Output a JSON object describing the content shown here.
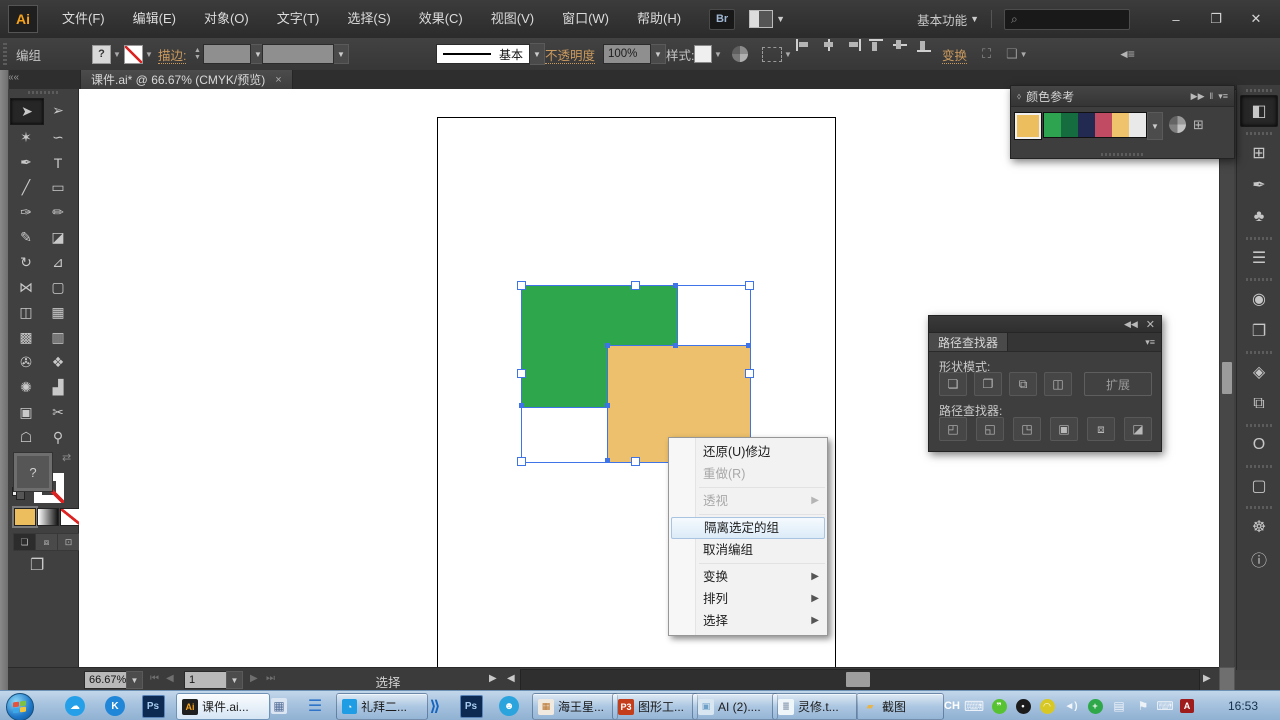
{
  "menu_bar": {
    "logo": "Ai",
    "items": [
      "文件(F)",
      "编辑(E)",
      "对象(O)",
      "文字(T)",
      "选择(S)",
      "效果(C)",
      "视图(V)",
      "窗口(W)",
      "帮助(H)"
    ],
    "bridge_button": "Br",
    "workspace_switcher": "基本功能",
    "window_controls": {
      "minimize": "–",
      "maximize": "❐",
      "close": "✕"
    }
  },
  "control_bar": {
    "selection_type": "编组",
    "fill_indicator": "?",
    "stroke_label": "描边:",
    "brush_definition": "基本",
    "opacity_label": "不透明度",
    "opacity_value": "100%",
    "style_label": "样式:",
    "transform_label": "变换"
  },
  "tab_bar": {
    "document_title": "课件.ai* @ 66.67% (CMYK/预览)",
    "close": "×"
  },
  "toolbar": {
    "fill_value": "?",
    "tools": [
      {
        "name": "selection-tool",
        "glyph": "➤",
        "active": true
      },
      {
        "name": "direct-selection-tool",
        "glyph": "➢",
        "active": false
      },
      {
        "name": "magic-wand-tool",
        "glyph": "✶",
        "active": false
      },
      {
        "name": "lasso-tool",
        "glyph": "∽",
        "active": false
      },
      {
        "name": "pen-tool",
        "glyph": "✒",
        "active": false
      },
      {
        "name": "type-tool",
        "glyph": "T",
        "active": false
      },
      {
        "name": "line-segment-tool",
        "glyph": "╱",
        "active": false
      },
      {
        "name": "rectangle-tool",
        "glyph": "▭",
        "active": false
      },
      {
        "name": "paintbrush-tool",
        "glyph": "✑",
        "active": false
      },
      {
        "name": "pencil-tool",
        "glyph": "✏",
        "active": false
      },
      {
        "name": "blob-brush-tool",
        "glyph": "✎",
        "active": false
      },
      {
        "name": "eraser-tool",
        "glyph": "◪",
        "active": false
      },
      {
        "name": "rotate-tool",
        "glyph": "↻",
        "active": false
      },
      {
        "name": "scale-tool",
        "glyph": "⊿",
        "active": false
      },
      {
        "name": "width-tool",
        "glyph": "⋈",
        "active": false
      },
      {
        "name": "free-transform-tool",
        "glyph": "▢",
        "active": false
      },
      {
        "name": "shape-builder-tool",
        "glyph": "◫",
        "active": false
      },
      {
        "name": "perspective-grid-tool",
        "glyph": "▦",
        "active": false
      },
      {
        "name": "mesh-tool",
        "glyph": "▩",
        "active": false
      },
      {
        "name": "gradient-tool",
        "glyph": "▥",
        "active": false
      },
      {
        "name": "eyedropper-tool",
        "glyph": "✇",
        "active": false
      },
      {
        "name": "blend-tool",
        "glyph": "❖",
        "active": false
      },
      {
        "name": "symbol-sprayer-tool",
        "glyph": "✺",
        "active": false
      },
      {
        "name": "column-graph-tool",
        "glyph": "▟",
        "active": false
      },
      {
        "name": "artboard-tool",
        "glyph": "▣",
        "active": false
      },
      {
        "name": "slice-tool",
        "glyph": "✂",
        "active": false
      },
      {
        "name": "hand-tool",
        "glyph": "☖",
        "active": false
      },
      {
        "name": "zoom-tool",
        "glyph": "⚲",
        "active": false
      }
    ]
  },
  "canvas": {
    "selection_color": "#3F74E8",
    "shapes": {
      "green": "#2EA64B",
      "orange": "#ECC06C"
    }
  },
  "context_menu": {
    "undo": "还原(U)修边",
    "redo": "重做(R)",
    "perspective": "透视",
    "isolate": "隔离选定的组",
    "ungroup": "取消编组",
    "transform": "变换",
    "arrange": "排列",
    "select": "选择"
  },
  "color_guide": {
    "title": "颜色参考",
    "base_color": "#EDBE5E",
    "harmony_colors": [
      "#2EA450",
      "#156C3F",
      "#232A52",
      "#C14B63",
      "#EFC36C",
      "#E9E9E9"
    ]
  },
  "pathfinder": {
    "title": "路径查找器",
    "shape_modes_label": "形状模式:",
    "expand_button": "扩展",
    "pathfinder_label": "路径查找器:",
    "shape_mode_buttons": [
      {
        "name": "unite-button",
        "glyph": "❏"
      },
      {
        "name": "minus-front-button",
        "glyph": "❐"
      },
      {
        "name": "intersect-button",
        "glyph": "⧉"
      },
      {
        "name": "exclude-button",
        "glyph": "◫"
      }
    ],
    "pathfinder_buttons": [
      {
        "name": "divide-button",
        "glyph": "◰"
      },
      {
        "name": "trim-button",
        "glyph": "◱"
      },
      {
        "name": "merge-button",
        "glyph": "◳"
      },
      {
        "name": "crop-button",
        "glyph": "▣"
      },
      {
        "name": "outline-button",
        "glyph": "⧈"
      },
      {
        "name": "minus-back-button",
        "glyph": "◪"
      }
    ]
  },
  "dock": {
    "icons": [
      {
        "name": "color-panel-icon",
        "glyph": "◧",
        "active": true,
        "grip": true
      },
      {
        "name": "swatches-panel-icon",
        "glyph": "⊞",
        "active": false,
        "grip": true
      },
      {
        "name": "brushes-panel-icon",
        "glyph": "✒",
        "active": false,
        "grip": false
      },
      {
        "name": "symbols-panel-icon",
        "glyph": "♣",
        "active": false,
        "grip": false
      },
      {
        "name": "stroke-panel-icon",
        "glyph": "☰",
        "active": false,
        "grip": true
      },
      {
        "name": "gradient-panel-icon",
        "glyph": "◉",
        "active": false,
        "grip": true
      },
      {
        "name": "transparency-panel-icon",
        "glyph": "❐",
        "active": false,
        "grip": false
      },
      {
        "name": "layers-panel-icon",
        "glyph": "◈",
        "active": false,
        "grip": true
      },
      {
        "name": "pathfinder-panel-icon",
        "glyph": "⧉",
        "active": false,
        "grip": false
      },
      {
        "name": "opentype-panel-icon",
        "glyph": "O",
        "active": false,
        "grip": true
      },
      {
        "name": "artboards-panel-icon",
        "glyph": "▢",
        "active": false,
        "grip": true
      },
      {
        "name": "navigator-panel-icon",
        "glyph": "☸",
        "active": false,
        "grip": true
      },
      {
        "name": "info-panel-icon",
        "glyph": "ⓘ",
        "active": false,
        "grip": false
      }
    ]
  },
  "status_bar": {
    "zoom_value": "66.67%",
    "page_value": "1",
    "status_text": "选择"
  },
  "taskbar": {
    "tasks": [
      {
        "label": "课件.ai..."
      },
      {
        "label": "礼拜二..."
      },
      {
        "label": "海王星..."
      },
      {
        "label": "图形工..."
      },
      {
        "label": "AI (2)...."
      },
      {
        "label": "灵修.t..."
      },
      {
        "label": "截图"
      }
    ],
    "task_icons": {
      "ai": "Ai",
      "ppt": "P3",
      "grid": "▦",
      "image": "▣",
      "notes": "≣",
      "folder": "▰"
    },
    "tray_language": "CH",
    "time": "16:53"
  }
}
